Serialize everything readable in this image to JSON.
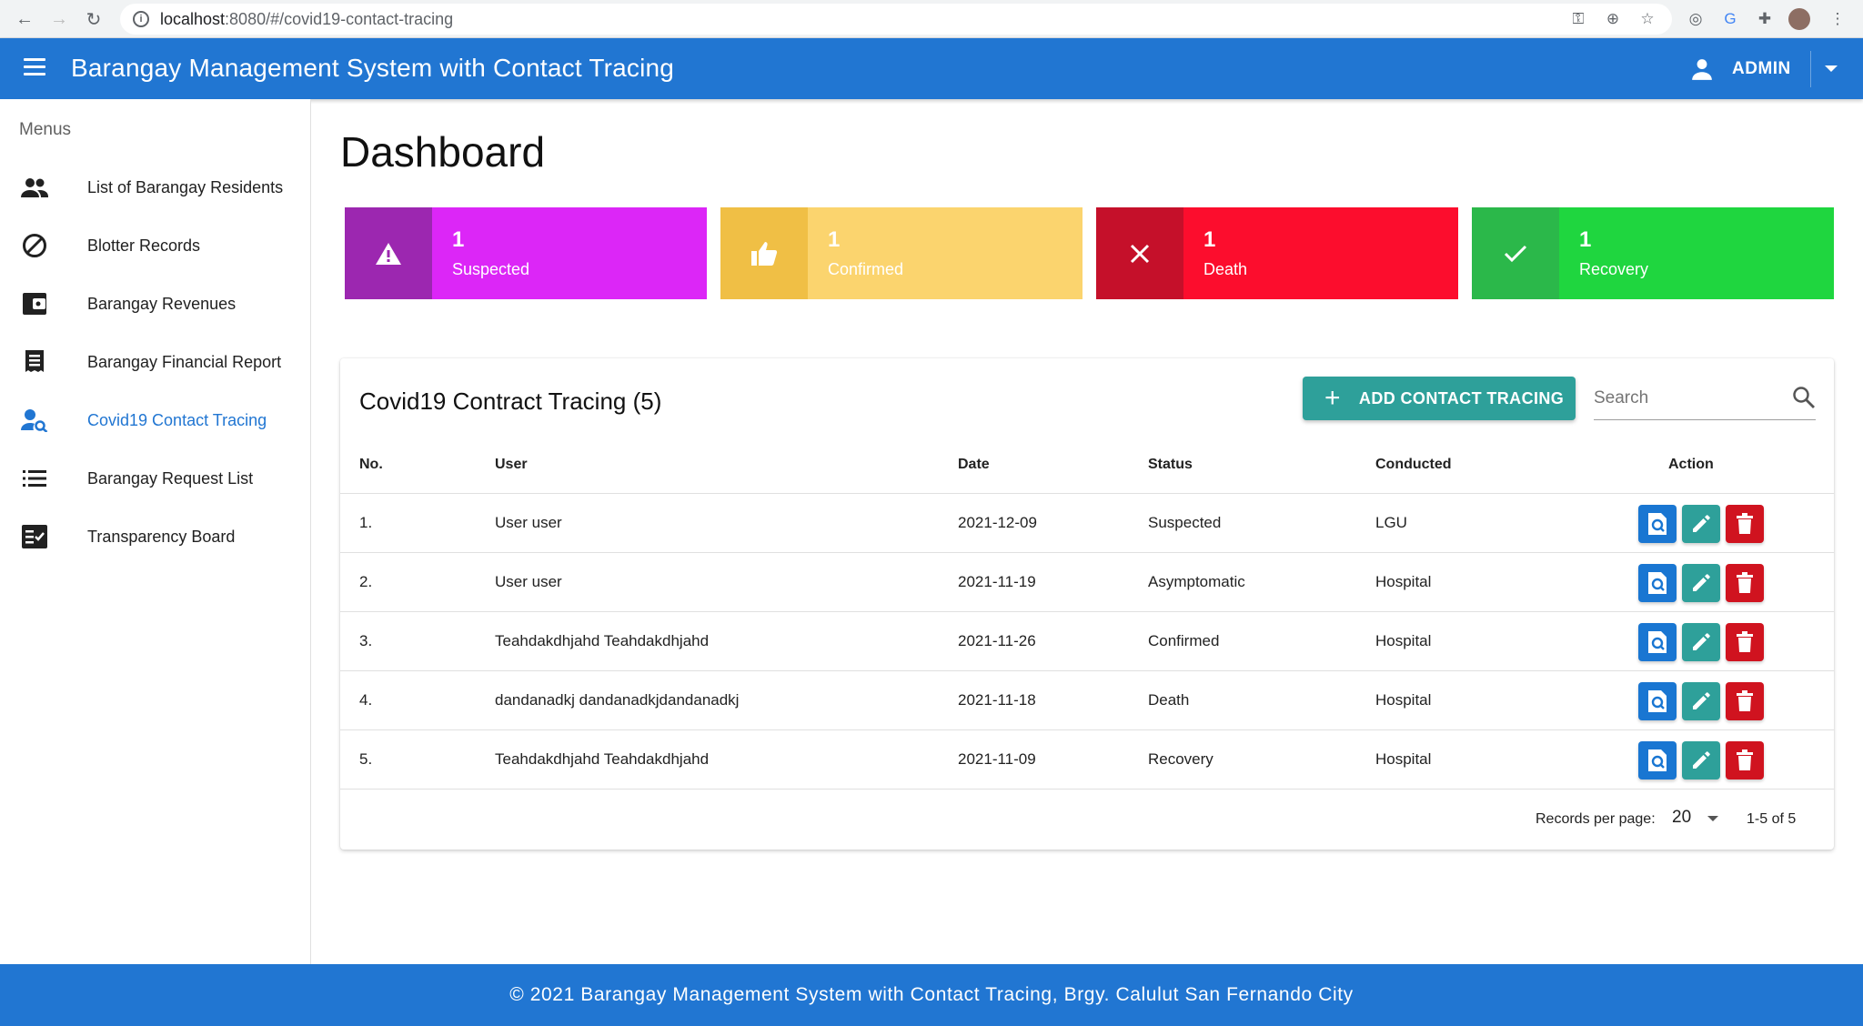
{
  "browser": {
    "url_host": "localhost",
    "url_path": ":8080/#/covid19-contact-tracing"
  },
  "appbar": {
    "title": "Barangay Management System with Contact Tracing",
    "user_label": "ADMIN"
  },
  "sidebar": {
    "heading": "Menus",
    "items": [
      {
        "label": "List of Barangay Residents",
        "icon": "people-icon"
      },
      {
        "label": "Blotter Records",
        "icon": "block-icon"
      },
      {
        "label": "Barangay Revenues",
        "icon": "wallet-icon"
      },
      {
        "label": "Barangay Financial Report",
        "icon": "receipt-icon"
      },
      {
        "label": "Covid19 Contact Tracing",
        "icon": "person-search-icon",
        "active": true
      },
      {
        "label": "Barangay Request List",
        "icon": "list-icon"
      },
      {
        "label": "Transparency Board",
        "icon": "checklist-icon"
      }
    ]
  },
  "page": {
    "title": "Dashboard"
  },
  "stats": [
    {
      "count": "1",
      "label": "Suspected",
      "icon": "warning-icon",
      "icon_bg": "#9c27b0",
      "bg": "#dc26f7"
    },
    {
      "count": "1",
      "label": "Confirmed",
      "icon": "thumb-up-icon",
      "icon_bg": "#f0bf45",
      "bg": "#fbd46e"
    },
    {
      "count": "1",
      "label": "Death",
      "icon": "close-icon",
      "icon_bg": "#c5102a",
      "bg": "#fc0d2d"
    },
    {
      "count": "1",
      "label": "Recovery",
      "icon": "check-icon",
      "icon_bg": "#2bb84a",
      "bg": "#1fd63f"
    }
  ],
  "table": {
    "title": "Covid19 Contract Tracing (5)",
    "add_button": "ADD CONTACT TRACING",
    "search_placeholder": "Search",
    "headers": {
      "no": "No.",
      "user": "User",
      "date": "Date",
      "status": "Status",
      "conducted": "Conducted",
      "action": "Action"
    },
    "rows": [
      {
        "no": "1.",
        "user": "User user",
        "date": "2021-12-09",
        "status": "Suspected",
        "conducted": "LGU"
      },
      {
        "no": "2.",
        "user": "User user",
        "date": "2021-11-19",
        "status": "Asymptomatic",
        "conducted": "Hospital"
      },
      {
        "no": "3.",
        "user": "Teahdakdhjahd Teahdakdhjahd",
        "date": "2021-11-26",
        "status": "Confirmed",
        "conducted": "Hospital"
      },
      {
        "no": "4.",
        "user": "dandanadkj dandanadkjdandanadkj",
        "date": "2021-11-18",
        "status": "Death",
        "conducted": "Hospital"
      },
      {
        "no": "5.",
        "user": "Teahdakdhjahd Teahdakdhjahd",
        "date": "2021-11-09",
        "status": "Recovery",
        "conducted": "Hospital"
      }
    ],
    "pagination": {
      "per_page_label": "Records per page:",
      "per_page_value": "20",
      "range": "1-5 of 5"
    }
  },
  "footer": {
    "text": "© 2021 Barangay Management System with Contact Tracing, Brgy. Calulut San Fernando City"
  },
  "colors": {
    "primary": "#2176d2",
    "teal": "#2ea09a",
    "danger": "#d0131f"
  }
}
